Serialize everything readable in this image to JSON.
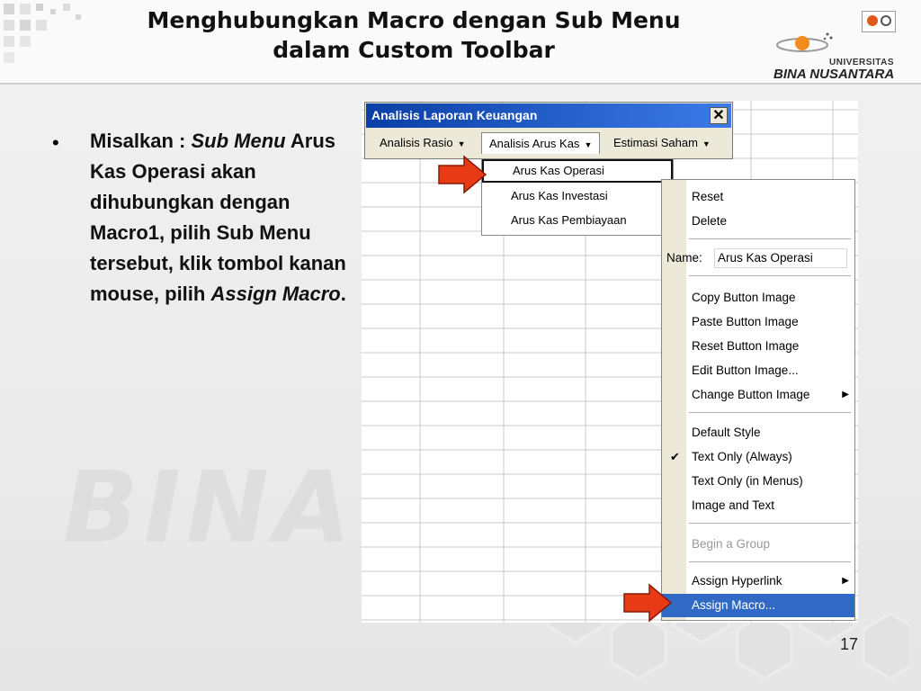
{
  "slide": {
    "title_line1": "Menghubungkan Macro dengan Sub Menu",
    "title_line2": "dalam Custom Toolbar",
    "logo": {
      "univ": "UNIVERSITAS",
      "name": "BINA NUSANTARA"
    },
    "watermark": "BINA N",
    "page_number": "17",
    "bullet": {
      "p1": "Misalkan : ",
      "i1": "Sub Menu",
      "p2": " Arus Kas Operasi akan dihubungkan dengan Macro1, pilih Sub Menu tersebut, klik tombol kanan mouse, pilih ",
      "i2": "Assign Macro",
      "p3": "."
    }
  },
  "toolbar": {
    "title": "Analisis Laporan Keuangan",
    "close": "✕",
    "menus": [
      "Analisis Rasio",
      "Analisis Arus Kas",
      "Estimasi Saham"
    ]
  },
  "submenu": {
    "items": [
      "Arus Kas Operasi",
      "Arus Kas Investasi",
      "Arus Kas Pembiayaan"
    ]
  },
  "context_menu": {
    "reset": "Reset",
    "delete": "Delete",
    "name_label": "Name:",
    "name_value": "Arus Kas Operasi",
    "copy_image": "Copy Button Image",
    "paste_image": "Paste Button Image",
    "reset_image": "Reset Button Image",
    "edit_image": "Edit Button Image...",
    "change_image": "Change Button Image",
    "default_style": "Default Style",
    "text_only_always": "Text Only (Always)",
    "text_only_menus": "Text Only (in Menus)",
    "image_and_text": "Image and Text",
    "begin_group": "Begin a Group",
    "assign_hyperlink": "Assign Hyperlink",
    "assign_macro": "Assign Macro..."
  },
  "colors": {
    "title_bar": "#0a3fa6",
    "menu_bg": "#ece9d8",
    "highlight": "#316ac5",
    "arrow": "#e83a14"
  }
}
